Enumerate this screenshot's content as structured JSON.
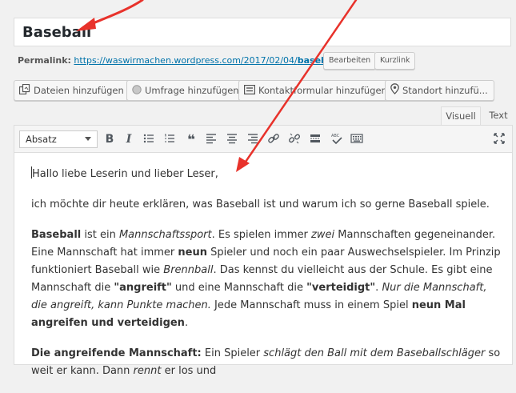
{
  "post": {
    "title": "Baseball",
    "permalink_label": "Permalink:",
    "permalink_base": "https://waswirmachen.wordpress.com/2017/02/04/",
    "permalink_slug": "baseball",
    "permalink_trailing": "/",
    "edit_button": "Bearbeiten",
    "shortlink_button": "Kurzlink"
  },
  "media_buttons": [
    {
      "label": "Dateien hinzufügen",
      "icon": "media-icon"
    },
    {
      "label": "Umfrage hinzufügen",
      "icon": "poll-icon"
    },
    {
      "label": "Kontaktformular hinzufügen",
      "icon": "form-icon"
    },
    {
      "label": "Standort hinzufü...",
      "icon": "location-icon"
    }
  ],
  "tabs": {
    "visual": "Visuell",
    "text": "Text"
  },
  "toolbar": {
    "format": "Absatz",
    "bold": "B",
    "italic": "I"
  },
  "content": {
    "greeting": "Hallo liebe Leserin und lieber Leser,",
    "intro": "ich möchte dir heute erklären, was Baseball ist und warum ich so gerne Baseball spiele.",
    "p3": {
      "b1": "Baseball",
      "t1": " ist ein ",
      "i1": "Mannschaftssport",
      "t2": ". Es spielen immer ",
      "i2": "zwei",
      "t3": " Mannschaften gegeneinander. Eine Mannschaft hat immer ",
      "b2": "neun",
      "t4": " Spieler und noch ein paar Auswechselspieler. Im Prinzip funktioniert Baseball wie ",
      "i3": "Brennball",
      "t5": ". Das kennst du vielleicht aus der Schule. Es gibt eine Mannschaft die ",
      "b3": "\"angreift\"",
      "t6": " und eine Mannschaft die ",
      "b4": "\"verteidigt\"",
      "t7": ". ",
      "i4": "Nur die Mannschaft, die angreift, kann Punkte machen.",
      "t8": " Jede Mannschaft muss in einem Spiel ",
      "b5": "neun Mal angreifen und verteidigen",
      "t9": "."
    },
    "p4": {
      "b1": "Die angreifende Mannschaft:",
      "t1": " Ein Spieler ",
      "i1": "schlägt den Ball mit dem Baseballschläger",
      "t2": " so weit er kann. Dann ",
      "i2": "rennt",
      "t3": " er los und"
    }
  },
  "colors": {
    "link": "#0073aa",
    "annotation_arrow": "#e8322b"
  }
}
